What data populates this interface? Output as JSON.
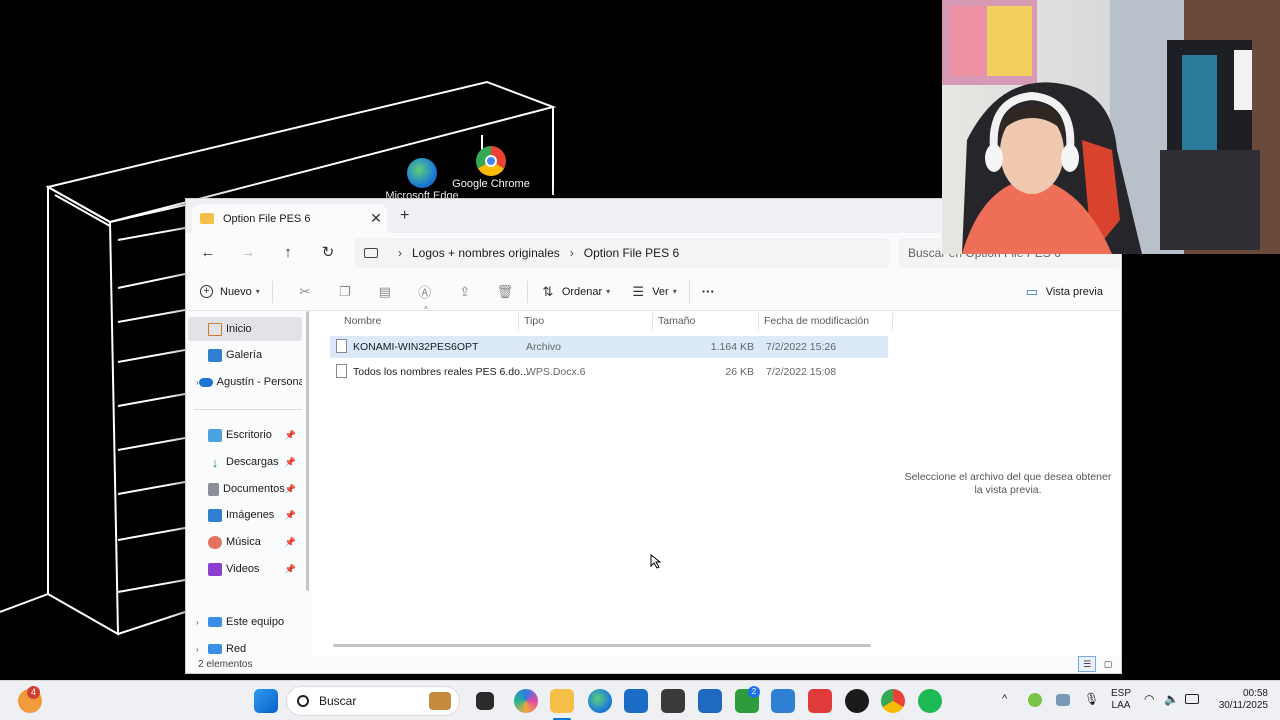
{
  "desktop": {
    "icons": [
      {
        "label": "Microsoft Edge",
        "icon": "edge-icon"
      },
      {
        "label": "Google Chrome",
        "icon": "chrome-icon"
      }
    ]
  },
  "window": {
    "tab_title": "Option File PES 6",
    "new_tab_label": "+",
    "breadcrumb": [
      "Logos + nombres originales",
      "Option File PES 6"
    ],
    "search_placeholder": "Buscar en Option File PES 6"
  },
  "toolbar": {
    "new_label": "Nuevo",
    "sort_label": "Ordenar",
    "view_label": "Ver",
    "more_label": "···",
    "preview_label": "Vista previa"
  },
  "nav": {
    "items": [
      {
        "label": "Inicio",
        "icon": "home-icon",
        "selected": true
      },
      {
        "label": "Galería",
        "icon": "gallery-icon"
      },
      {
        "label": "Agustín - Personal",
        "icon": "onedrive-icon",
        "expandable": true
      },
      {
        "label": "Escritorio",
        "icon": "desktop-folder-icon",
        "pinned": true
      },
      {
        "label": "Descargas",
        "icon": "downloads-icon",
        "pinned": true
      },
      {
        "label": "Documentos",
        "icon": "documents-icon",
        "pinned": true
      },
      {
        "label": "Imágenes",
        "icon": "pictures-icon",
        "pinned": true
      },
      {
        "label": "Música",
        "icon": "music-icon",
        "pinned": true
      },
      {
        "label": "Videos",
        "icon": "videos-icon",
        "pinned": true
      },
      {
        "label": "Este equipo",
        "icon": "this-pc-icon",
        "expandable": true
      },
      {
        "label": "Red",
        "icon": "network-icon",
        "expandable": true
      }
    ]
  },
  "files": {
    "columns": [
      "Nombre",
      "Tipo",
      "Tamaño",
      "Fecha de modificación"
    ],
    "rows": [
      {
        "name": "KONAMI-WIN32PES6OPT",
        "type": "Archivo",
        "size": "1.164 KB",
        "date": "7/2/2022 15:26",
        "selected": true
      },
      {
        "name": "Todos los nombres reales PES 6.do...",
        "type": "WPS.Docx.6",
        "size": "26 KB",
        "date": "7/2/2022 15:08"
      }
    ]
  },
  "preview": {
    "message": "Seleccione el archivo del que desea obtener la vista previa."
  },
  "status": {
    "count": "2 elementos"
  },
  "taskbar": {
    "search_label": "Buscar",
    "notification_badge": "4",
    "xbox_badge": "2",
    "language": "ESP",
    "layout": "LAA",
    "time": "00:58",
    "date": "30/11/2025"
  },
  "colors": {
    "selection": "#dbe9f9",
    "nav_selected": "#e1e3e7",
    "folder": "#f5c04a",
    "accent": "#0078d4"
  }
}
